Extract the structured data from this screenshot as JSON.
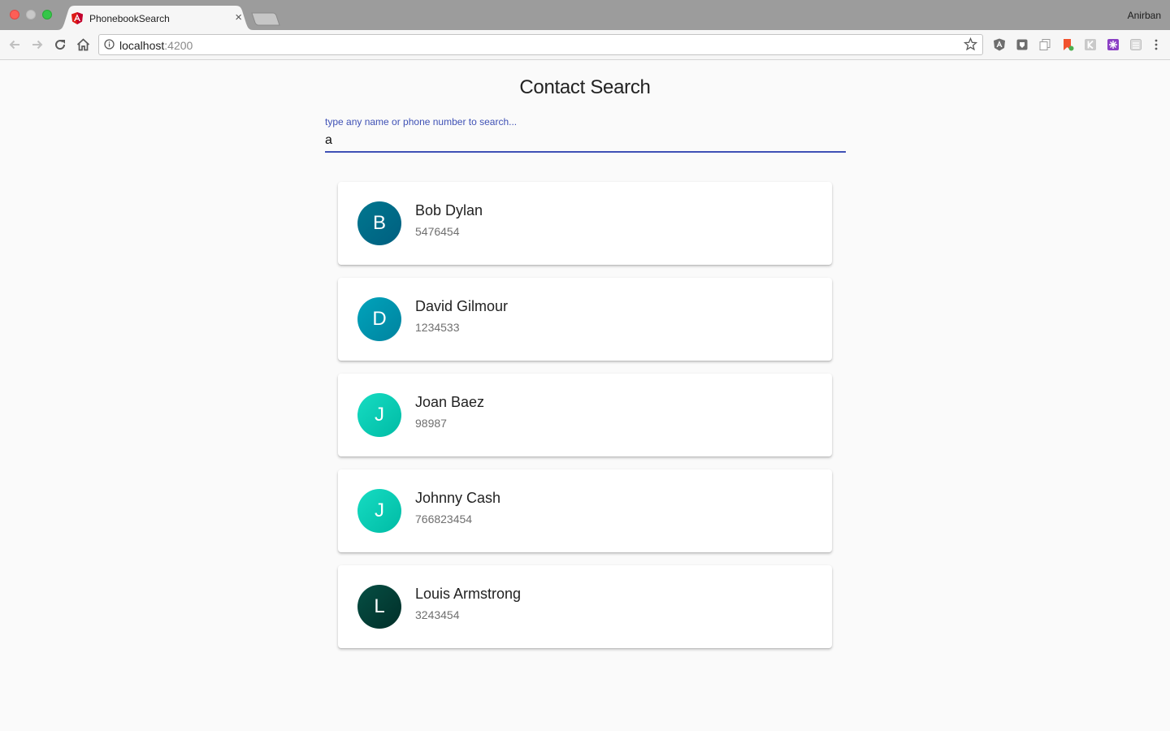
{
  "browser": {
    "tab_title": "PhonebookSearch",
    "tab_close": "×",
    "profile_name": "Anirban",
    "url_host": "localhost",
    "url_port": ":4200"
  },
  "page": {
    "title": "Contact Search",
    "search": {
      "label": "type any name or phone number to search...",
      "value": "a"
    }
  },
  "contacts": [
    {
      "initial": "B",
      "name": "Bob Dylan",
      "phone": "5476454",
      "color_from": "#00778f",
      "color_to": "#005f80"
    },
    {
      "initial": "D",
      "name": "David Gilmour",
      "phone": "1234533",
      "color_from": "#00a3bb",
      "color_to": "#00839f"
    },
    {
      "initial": "J",
      "name": "Joan Baez",
      "phone": "98987",
      "color_from": "#16dcc2",
      "color_to": "#00bba5"
    },
    {
      "initial": "J",
      "name": "Johnny Cash",
      "phone": "766823454",
      "color_from": "#16dcc2",
      "color_to": "#00bba5"
    },
    {
      "initial": "L",
      "name": "Louis Armstrong",
      "phone": "3243454",
      "color_from": "#064f44",
      "color_to": "#012f29"
    }
  ],
  "colors": {
    "accent": "#3f51b5",
    "page_bg": "#fafafa",
    "tabbar_bg": "#9c9c9c"
  },
  "icons": {
    "back": "arrow-left-icon",
    "forward": "arrow-right-icon",
    "reload": "reload-icon",
    "home": "home-icon",
    "info": "info-icon",
    "bookmark": "star-icon"
  }
}
